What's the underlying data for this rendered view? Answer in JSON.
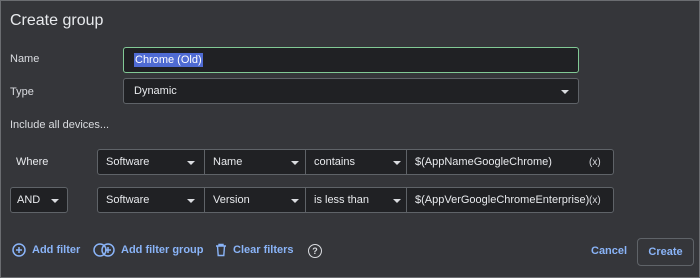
{
  "dialog": {
    "title": "Create group",
    "name_label": "Name",
    "name_value": "Chrome (Old)",
    "type_label": "Type",
    "type_value": "Dynamic",
    "include_text": "Include all devices..."
  },
  "rules": [
    {
      "connector": "Where",
      "source": "Software",
      "field": "Name",
      "operator": "contains",
      "value": "$(AppNameGoogleChrome)",
      "clear": "(x)"
    },
    {
      "connector": "AND",
      "source": "Software",
      "field": "Version",
      "operator": "is less than",
      "value": "$(AppVerGoogleChromeEnterprise)",
      "clear": "(x)"
    }
  ],
  "footer": {
    "add_filter": "Add filter",
    "add_filter_group": "Add filter group",
    "clear_filters": "Clear filters",
    "help": "?",
    "cancel": "Cancel",
    "create": "Create"
  },
  "colors": {
    "background": "#35363a",
    "accent": "#8ab4f8",
    "focus": "#81c995",
    "selection": "#4f6bd3"
  }
}
